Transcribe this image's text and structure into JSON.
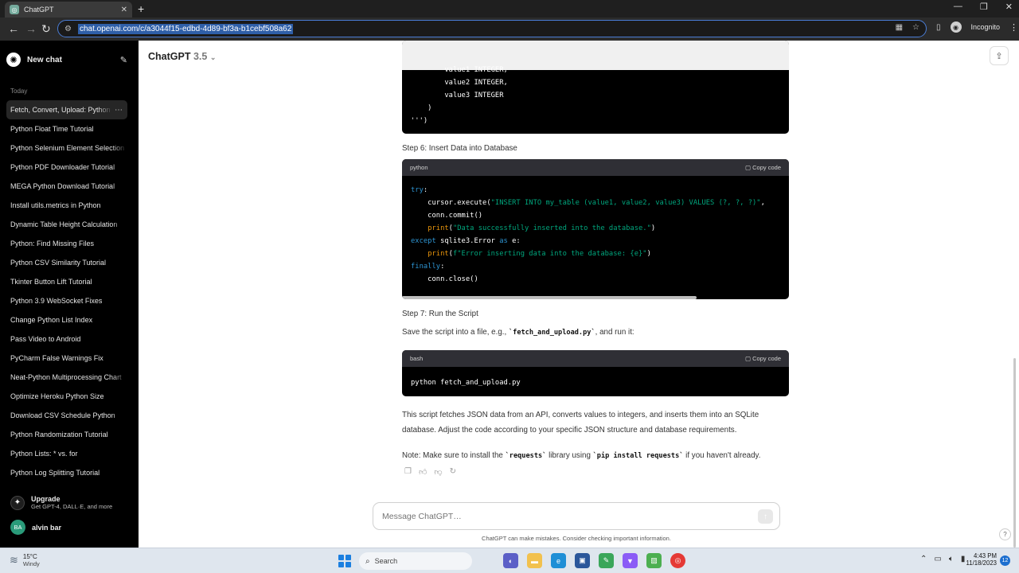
{
  "browser": {
    "tab_title": "ChatGPT",
    "tab_close": "✕",
    "new_tab": "+",
    "url": "chat.openai.com/c/a3044f15-edbd-4d89-bf3a-b1cebf508a62",
    "profile_label": "Incognito",
    "win_min": "—",
    "win_max": "❐",
    "win_close": "✕"
  },
  "sidebar": {
    "new_chat_label": "New chat",
    "section_label": "Today",
    "items": [
      {
        "label": "Fetch, Convert, Upload: Python",
        "active": true
      },
      {
        "label": "Python Float Time Tutorial"
      },
      {
        "label": "Python Selenium Element Selection"
      },
      {
        "label": "Python PDF Downloader Tutorial"
      },
      {
        "label": "MEGA Python Download Tutorial"
      },
      {
        "label": "Install utils.metrics in Python"
      },
      {
        "label": "Dynamic Table Height Calculation"
      },
      {
        "label": "Python: Find Missing Files"
      },
      {
        "label": "Python CSV Similarity Tutorial"
      },
      {
        "label": "Tkinter Button Lift Tutorial"
      },
      {
        "label": "Python 3.9 WebSocket Fixes"
      },
      {
        "label": "Change Python List Index"
      },
      {
        "label": "Pass Video to Android"
      },
      {
        "label": "PyCharm False Warnings Fix"
      },
      {
        "label": "Neat-Python Multiprocessing Chart"
      },
      {
        "label": "Optimize Heroku Python Size"
      },
      {
        "label": "Download CSV Schedule Python"
      },
      {
        "label": "Python Randomization Tutorial"
      },
      {
        "label": "Python Lists: * vs. for"
      },
      {
        "label": "Python Log Splitting Tutorial"
      }
    ],
    "upgrade_title": "Upgrade",
    "upgrade_sub": "Get GPT-4, DALL·E, and more",
    "user_initials": "BA",
    "user_name": "alvin bar"
  },
  "main": {
    "model_name": "ChatGPT",
    "model_version": "3.5",
    "code1_tail": "        value1 INTEGER,\n        value2 INTEGER,\n        value3 INTEGER\n    )\n''')",
    "step6_heading": "Step 6: Insert Data into Database",
    "code2_lang": "python",
    "copy_label": "Copy code",
    "code2_lines": {
      "l1": "try",
      "l2a": "    cursor.execute(",
      "l2b": "\"INSERT INTO my_table (value1, value2, value3) VALUES (?, ?, ?)\"",
      "l2c": ",",
      "l3": "    conn.commit()",
      "l4a": "    ",
      "l4fn": "print",
      "l4b": "(",
      "l4s": "\"Data successfully inserted into the database.\"",
      "l4c": ")",
      "l5kw": "except",
      "l5a": " sqlite3.Error ",
      "l5as": "as",
      "l5b": " e:",
      "l6a": "    ",
      "l6fn": "print",
      "l6b": "(",
      "l6s": "f\"Error inserting data into the database: {e}\"",
      "l6c": ")",
      "l7": "finally",
      "l8": "    conn.close()"
    },
    "step7_heading": "Step 7: Run the Script",
    "save_text_a": "Save the script into a file, e.g., ",
    "save_code": "`fetch_and_upload.py`",
    "save_text_b": ", and run it:",
    "code3_lang": "bash",
    "code3_body": "python fetch_and_upload.py",
    "summary_line1": "This script fetches JSON data from an API, converts values to integers, and inserts them into an SQLite",
    "summary_line2": "database. Adjust the code according to your specific JSON structure and database requirements.",
    "note_a": "Note: Make sure to install the ",
    "note_code1": "`requests`",
    "note_b": " library using ",
    "note_code2": "`pip install requests`",
    "note_c": " if you haven't already.",
    "composer_placeholder": "Message ChatGPT…",
    "disclaimer": "ChatGPT can make mistakes. Consider checking important information.",
    "help": "?"
  },
  "taskbar": {
    "weather_temp": "15°C",
    "weather_cond": "Windy",
    "search_label": "Search",
    "time": "4:43 PM",
    "date": "11/18/2023",
    "notifications": "12"
  }
}
